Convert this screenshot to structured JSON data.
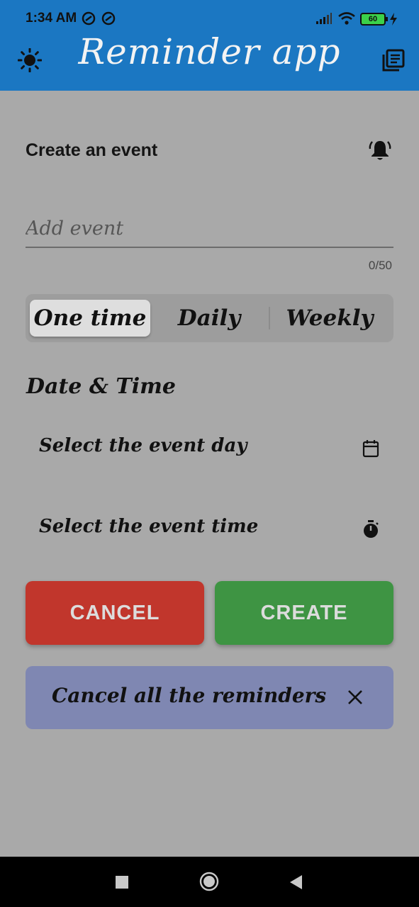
{
  "status_bar": {
    "time": "1:34 AM",
    "battery": "60",
    "icons": [
      "vpn-icon",
      "vpn-icon",
      "signal-icon",
      "wifi-icon",
      "battery-icon",
      "charging-icon"
    ]
  },
  "app_bar": {
    "title": "Reminder app",
    "left_icon": "brightness-icon",
    "right_icon": "library-icon",
    "color": "#1b77c2"
  },
  "create_section": {
    "heading": "Create an event",
    "icon": "bell-icon",
    "input_placeholder": "Add event",
    "input_value": "",
    "counter": "0/50"
  },
  "frequency": {
    "options": [
      "One time",
      "Daily",
      "Weekly"
    ],
    "selected": "One time"
  },
  "date_time": {
    "heading": "Date & Time",
    "day_label": "Select the event day",
    "day_icon": "calendar-icon",
    "time_label": "Select the event time",
    "time_icon": "stopwatch-icon"
  },
  "actions": {
    "cancel_label": "CANCEL",
    "create_label": "CREATE",
    "cancel_color": "#c1362c",
    "create_color": "#3e9443"
  },
  "cancel_all": {
    "label": "Cancel all the reminders",
    "icon": "close-icon"
  },
  "nav_bar": {
    "icons": [
      "recent-apps-icon",
      "home-icon",
      "back-icon"
    ]
  }
}
